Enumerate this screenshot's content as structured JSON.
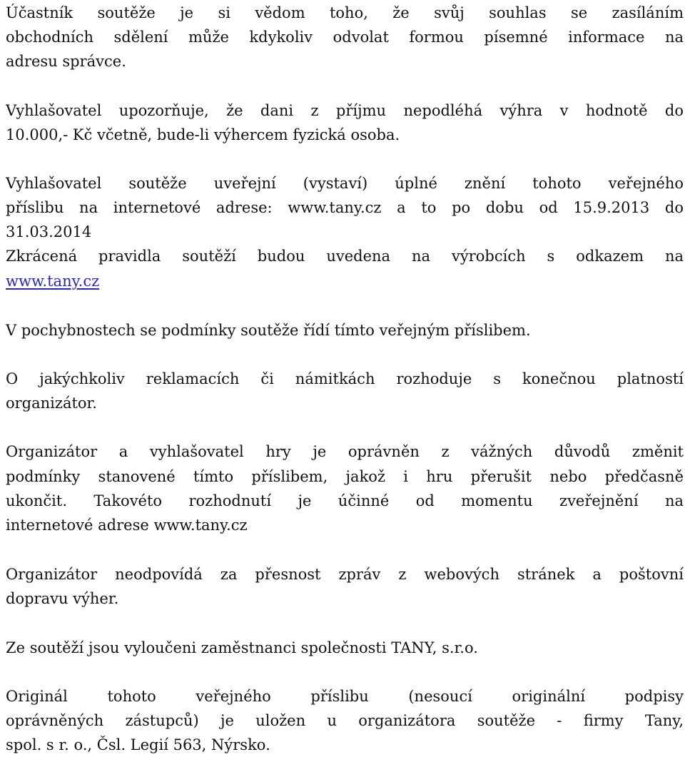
{
  "document": {
    "link_color": "#2a2a9c",
    "text_color": "#111111",
    "paragraphs": [
      {
        "id": "consent-withdrawal",
        "lines": [
          "Účastník soutěže je si vědom toho, že svůj souhlas se zasíláním",
          "obchodních sdělení může kdykoliv odvolat formou písemné informace na",
          "adresu správce."
        ]
      },
      {
        "id": "tax-notice",
        "lines": [
          "Vyhlašovatel upozorňuje, že dani z příjmu nepodléhá výhra v hodnotě do",
          "10.000,- Kč včetně, bude-li výhercem fyzická osoba."
        ]
      },
      {
        "id": "publication",
        "lines": [
          "Vyhlašovatel soutěže uveřejní (vystaví) úplné znění tohoto veřejného",
          "příslibu na internetové adrese: www.tany.cz a to po dobu od 15.9.2013 do",
          "31.03.2014"
        ]
      },
      {
        "id": "short-rules",
        "lines": [
          "Zkrácená pravidla soutěží budou uvedena na výrobcích s odkazem na"
        ],
        "link": "www.tany.cz"
      },
      {
        "id": "doubts",
        "lines": [
          "V pochybnostech se podmínky soutěže řídí tímto veřejným příslibem."
        ]
      },
      {
        "id": "complaints",
        "lines": [
          "O jakýchkoliv reklamacích či námitkách rozhoduje s konečnou platností",
          "organizátor."
        ]
      },
      {
        "id": "changes",
        "lines": [
          "Organizátor a vyhlašovatel hry je oprávněn z vážných důvodů změnit",
          "podmínky stanovené tímto příslibem, jakož i hru přerušit nebo předčasně",
          "ukončit. Takovéto rozhodnutí je účinné od momentu zveřejnění na",
          "internetové adrese www.tany.cz"
        ]
      },
      {
        "id": "liability",
        "lines": [
          "Organizátor  neodpovídá za přesnost zpráv z webových stránek a poštovní",
          "dopravu výher."
        ]
      },
      {
        "id": "exclusion",
        "lines": [
          "Ze soutěží jsou vyloučeni zaměstnanci společnosti TANY, s.r.o."
        ]
      },
      {
        "id": "original",
        "lines": [
          "Originál tohoto veřejného příslibu (nesoucí originální podpisy",
          "oprávněných zástupců) je uložen u organizátora soutěže - firmy Tany,",
          "spol. s r. o., Čsl. Legií 563, Nýrsko."
        ]
      }
    ]
  }
}
